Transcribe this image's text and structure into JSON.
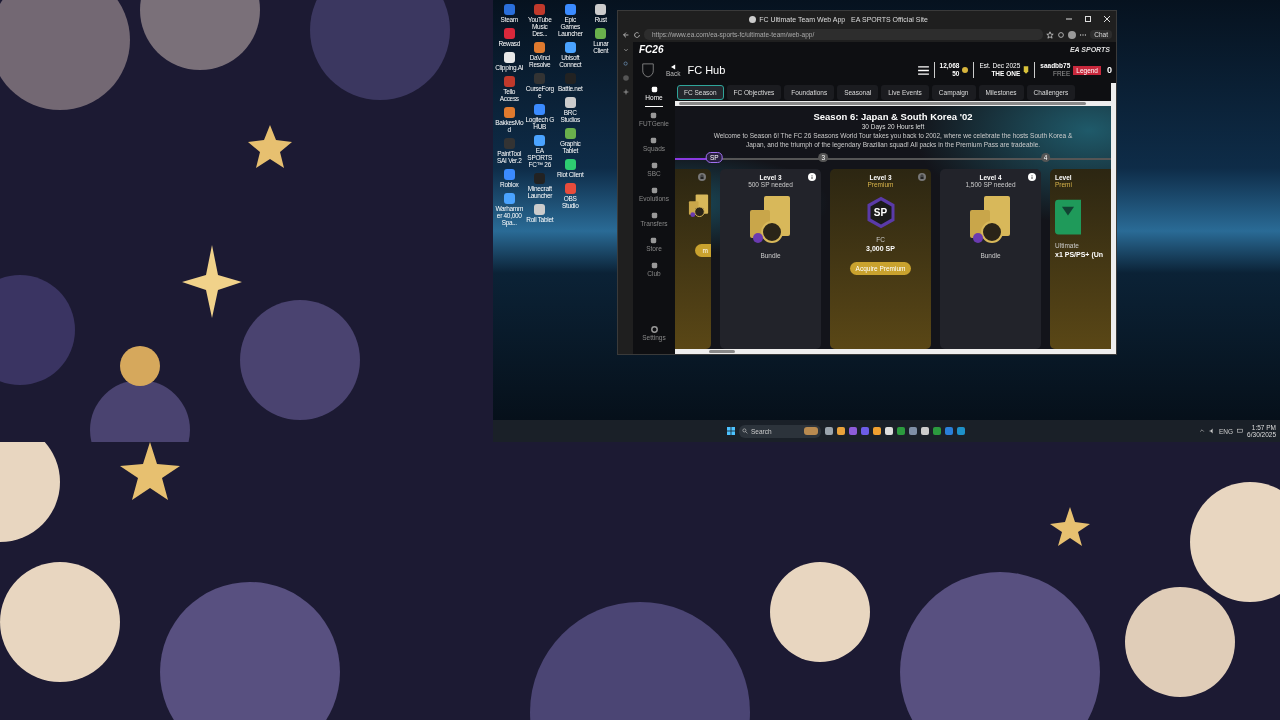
{
  "desktop": {
    "icon_columns": [
      [
        {
          "label": "Steam"
        },
        {
          "label": "Rewasd"
        },
        {
          "label": "Clipping.AI"
        },
        {
          "label": "Tello Access"
        },
        {
          "label": "BakkesMod"
        },
        {
          "label": "PaintTool SAI Ver.2"
        },
        {
          "label": "Roblox"
        },
        {
          "label": "Warhammer 40,000 Spa..."
        }
      ],
      [
        {
          "label": "YouTube Music Des..."
        },
        {
          "label": "DaVinci Resolve"
        },
        {
          "label": "CurseForge"
        },
        {
          "label": "Logitech G HUB"
        },
        {
          "label": "EA SPORTS FC™ 26"
        },
        {
          "label": "Minecraft Launcher"
        },
        {
          "label": "Roll Tablet"
        }
      ],
      [
        {
          "label": "Epic Games Launcher"
        },
        {
          "label": "Ubisoft Connect"
        },
        {
          "label": "Battle.net"
        },
        {
          "label": "BRC Studios"
        },
        {
          "label": "Graphic Tablet"
        },
        {
          "label": "Riot Client"
        },
        {
          "label": "OBS Studio"
        }
      ],
      [
        {
          "label": "Rust"
        },
        {
          "label": "Lunar Client"
        }
      ]
    ]
  },
  "browser": {
    "title": "FC Ultimate Team Web App   EA SPORTS Official Site",
    "url": "https://www.ea.com/ea-sports-fc/ultimate-team/web-app/",
    "chat": "Chat"
  },
  "app": {
    "logo": "FC26",
    "brand": "EA SPORTS",
    "back": "Back",
    "title": "FC Hub",
    "coins": "12,068",
    "points": "50",
    "club_est": "Est. Dec 2025",
    "club_name": "THE ONE",
    "username": "saadbb75",
    "user_tag": "FREE",
    "badge": "Legend",
    "notifications": "0",
    "sidebar": [
      {
        "label": "Home",
        "selected": true
      },
      {
        "label": "FUTGenie",
        "selected": false
      },
      {
        "label": "Squads",
        "selected": false
      },
      {
        "label": "SBC",
        "selected": false
      },
      {
        "label": "Evolutions",
        "selected": false
      },
      {
        "label": "Transfers",
        "selected": false
      },
      {
        "label": "Store",
        "selected": false
      },
      {
        "label": "Club",
        "selected": false
      }
    ],
    "settings": "Settings",
    "tabs": [
      {
        "label": "FC Season",
        "selected": true
      },
      {
        "label": "FC Objectives",
        "selected": false
      },
      {
        "label": "Foundations",
        "selected": false
      },
      {
        "label": "Seasonal",
        "selected": false
      },
      {
        "label": "Live Events",
        "selected": false
      },
      {
        "label": "Campaign",
        "selected": false
      },
      {
        "label": "Milestones",
        "selected": false
      },
      {
        "label": "Challengers",
        "selected": false
      }
    ],
    "season": {
      "title": "Season 6: Japan & South Korea '02",
      "time_left": "30 Days 20 Hours left",
      "description": "Welcome to Season 6! The FC 26 Seasons World Tour takes you back to 2002, where we celebrate the hosts South Korea & Japan, and the triumph of the legendary Brazilian squad! All packs in the Premium Pass are tradeable.",
      "track": {
        "level": 0.09,
        "markers": [
          "SP",
          "3",
          "4"
        ]
      },
      "cards": [
        {
          "kind": "pack",
          "premium": true,
          "button": "m"
        },
        {
          "kind": "pack",
          "premium": false,
          "level": "Level 3",
          "subtitle": "500 SP needed",
          "caption": "Bundle"
        },
        {
          "kind": "points",
          "premium": true,
          "level": "Level 3",
          "subtitle": "Premium",
          "badge": "SP",
          "caption": "FC",
          "value": "3,000 SP",
          "button": "Acquire Premium"
        },
        {
          "kind": "pack",
          "premium": false,
          "level": "Level 4",
          "subtitle": "1,500 SP needed",
          "caption": "Bundle"
        },
        {
          "kind": "item",
          "premium": true,
          "level": "Level",
          "subtitle": "Premi",
          "caption": "Ultimate",
          "value": "x1 PS/PS+ (Un"
        }
      ]
    }
  },
  "taskbar": {
    "search": "Search",
    "language": "ENG",
    "time": "1:57 PM",
    "date": "6/30/2025"
  }
}
